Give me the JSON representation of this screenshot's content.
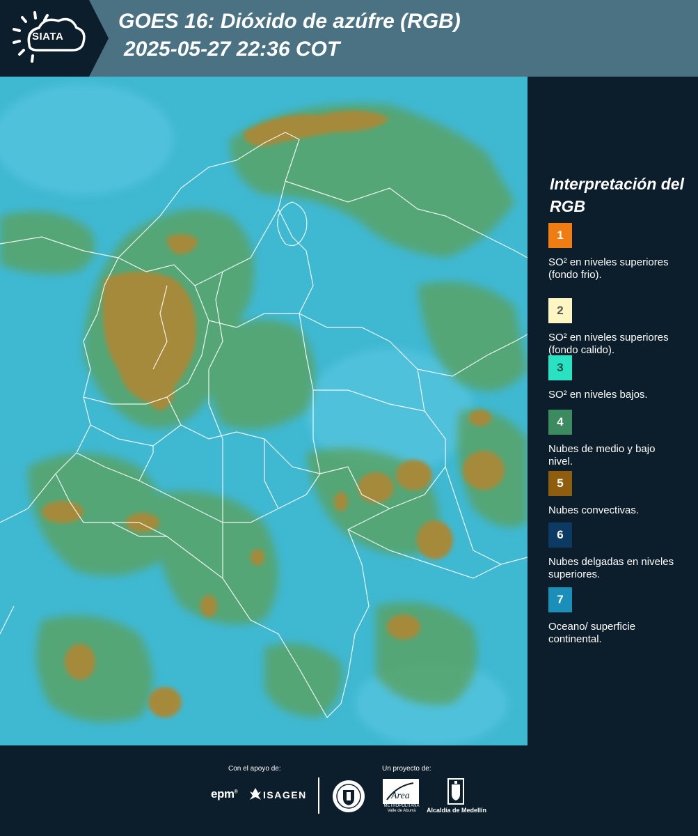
{
  "header": {
    "logo_text": "SIATA",
    "title_line1": "GOES 16: Dióxido de azúfre (RGB)",
    "title_line2": " 2025-05-27 22:36 COT"
  },
  "map": {
    "description": "Satellite RGB sulfur dioxide composite over Colombia with department borders",
    "colors": {
      "background": "#3fb8d2",
      "green": "#5aa15d",
      "convective": "#a58a3a",
      "border": "#ffffff"
    }
  },
  "legend": {
    "title": "Interpretación del RGB",
    "items": [
      {
        "number": "1",
        "color": "#f07d12",
        "text_color": "#ffffff",
        "label": "SO² en niveles superiores (fondo frio)."
      },
      {
        "number": "2",
        "color": "#fdf6c3",
        "text_color": "#555555",
        "label": "SO² en niveles superiores (fondo calido)."
      },
      {
        "number": "3",
        "color": "#29e2c2",
        "text_color": "#1d4f4a",
        "label": "SO² en niveles bajos."
      },
      {
        "number": "4",
        "color": "#3c8a60",
        "text_color": "#ffffff",
        "label": "Nubes de medio y bajo nivel."
      },
      {
        "number": "5",
        "color": "#8e5d0d",
        "text_color": "#ffffff",
        "label": "Nubes convectivas."
      },
      {
        "number": "6",
        "color": "#0d3a63",
        "text_color": "#ffffff",
        "label": "Nubes delgadas en niveles superiores."
      },
      {
        "number": "7",
        "color": "#1a8fba",
        "text_color": "#ffffff",
        "label": "Oceano/ superficie continental."
      }
    ]
  },
  "footer": {
    "support_label": "Con el apoyo de:",
    "project_label": "Un proyecto de:",
    "epm": "epm",
    "epm_mark": "®",
    "isagen": "ISAGEN",
    "area_title": "Área",
    "area_sub": "METROPOLITANA Valle de Aburrá",
    "alcaldia": "Alcaldía de Medellín"
  }
}
